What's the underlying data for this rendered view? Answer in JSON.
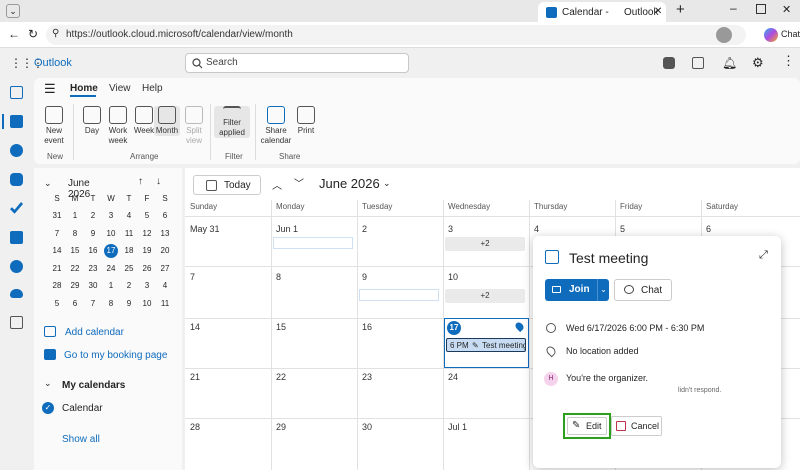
{
  "browser": {
    "tab_title": "Calendar -",
    "tab_app": "Outlook",
    "url": "https://outlook.cloud.microsoft/calendar/view/month",
    "copilot_label": "Chat"
  },
  "header": {
    "app_name": "Outlook",
    "search_placeholder": "Search"
  },
  "ribbon": {
    "tabs": [
      "Home",
      "View",
      "Help"
    ],
    "buttons": {
      "new_event": [
        "New",
        "event"
      ],
      "day": "Day",
      "work_week": [
        "Work",
        "week"
      ],
      "week": "Week",
      "month": "Month",
      "split_view": [
        "Split",
        "view"
      ],
      "filter": [
        "Filter",
        "applied"
      ],
      "share_calendar": [
        "Share",
        "calendar"
      ],
      "print": "Print"
    },
    "groups": {
      "new": "New",
      "arrange": "Arrange",
      "filter": "Filter",
      "share": "Share"
    }
  },
  "mini_calendar": {
    "title": "June 2026",
    "weekdays": [
      "S",
      "M",
      "T",
      "W",
      "T",
      "F",
      "S"
    ],
    "weeks": [
      [
        "31",
        "1",
        "2",
        "3",
        "4",
        "5",
        "6"
      ],
      [
        "7",
        "8",
        "9",
        "10",
        "11",
        "12",
        "13"
      ],
      [
        "14",
        "15",
        "16",
        "17",
        "18",
        "19",
        "20"
      ],
      [
        "21",
        "22",
        "23",
        "24",
        "25",
        "26",
        "27"
      ],
      [
        "28",
        "29",
        "30",
        "1",
        "2",
        "3",
        "4"
      ],
      [
        "5",
        "6",
        "7",
        "8",
        "9",
        "10",
        "11"
      ]
    ],
    "today": "17"
  },
  "left_nav": {
    "add_calendar": "Add calendar",
    "booking_page": "Go to my booking page",
    "my_calendars": "My calendars",
    "calendar": "Calendar",
    "show_all": "Show all"
  },
  "calendar": {
    "today_button": "Today",
    "month_title": "June 2026",
    "weekdays": [
      "Sunday",
      "Monday",
      "Tuesday",
      "Wednesday",
      "Thursday",
      "Friday",
      "Saturday"
    ],
    "weeks": [
      [
        "May 31",
        "Jun 1",
        "2",
        "3",
        "4",
        "5",
        "6"
      ],
      [
        "7",
        "8",
        "9",
        "10",
        "",
        "",
        ""
      ],
      [
        "14",
        "15",
        "16",
        "17",
        "",
        "",
        ""
      ],
      [
        "21",
        "22",
        "23",
        "24",
        "",
        "",
        ""
      ],
      [
        "28",
        "29",
        "30",
        "Jul 1",
        "",
        "",
        ""
      ]
    ],
    "more_label": "+2",
    "event_chip": {
      "time": "6 PM",
      "title": "Test meeting"
    }
  },
  "popup": {
    "title": "Test meeting",
    "join": "Join",
    "chat": "Chat",
    "datetime": "Wed 6/17/2026 6:00 PM - 6:30 PM",
    "location": "No location added",
    "organizer_initial": "H",
    "organizer_text": "You're the organizer.",
    "response_fragment": "lidn't respond.",
    "edit": "Edit",
    "cancel": "Cancel"
  },
  "colors": {
    "accent": "#0f6cbd",
    "highlight_border": "#2ca01c"
  }
}
